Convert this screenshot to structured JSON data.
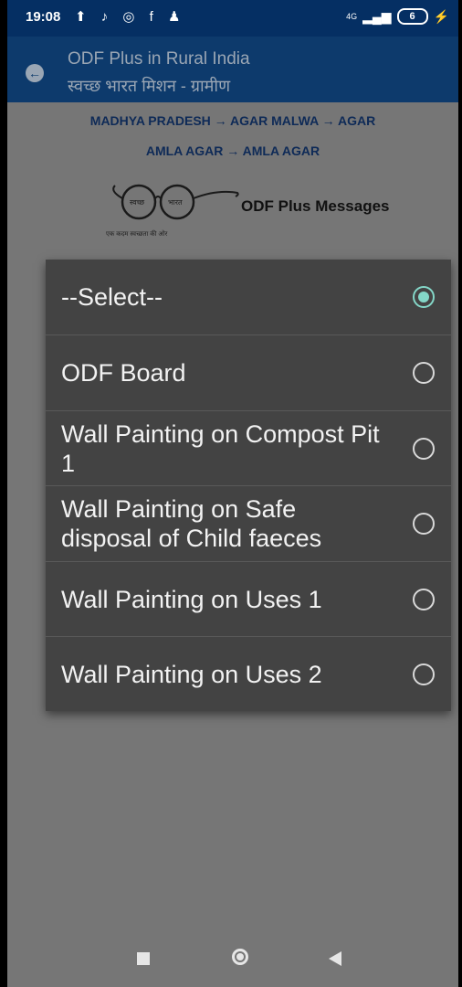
{
  "status_bar": {
    "time": "19:08",
    "left_icons": [
      "upload-icon",
      "tiktok-icon",
      "location-icon",
      "facebook-icon",
      "bell-icon"
    ],
    "left_glyphs": "⬆ ♪ ◎ f ♟",
    "network": "4G",
    "battery": "6"
  },
  "app_bar": {
    "title": "ODF Plus in Rural India",
    "subtitle": "स्वच्छ भारत मिशन - ग्रामीण"
  },
  "breadcrumb": {
    "line1": "MADHYA PRADESH → AGAR MALWA → AGAR",
    "line2": "AMLA AGAR → AMLA AGAR"
  },
  "logo": {
    "left_word": "स्वच्छ",
    "right_word": "भारत",
    "caption": "एक कदम स्वच्छता की ओर"
  },
  "header_label": "ODF Plus Messages",
  "dialog": {
    "options": [
      {
        "label": "--Select--",
        "selected": true
      },
      {
        "label": "ODF Board",
        "selected": false
      },
      {
        "label": "Wall Painting on Compost Pit 1",
        "selected": false
      },
      {
        "label": "Wall Painting on Safe disposal of Child faeces",
        "selected": false
      },
      {
        "label": "Wall Painting on Uses 1",
        "selected": false
      },
      {
        "label": "Wall Painting on Uses 2",
        "selected": false
      }
    ]
  },
  "colors": {
    "status_bar": "#052f63",
    "app_bar": "#0d3a6c",
    "dim_background": "#767676",
    "dialog": "#434343",
    "radio_selected": "#84d7c8"
  }
}
